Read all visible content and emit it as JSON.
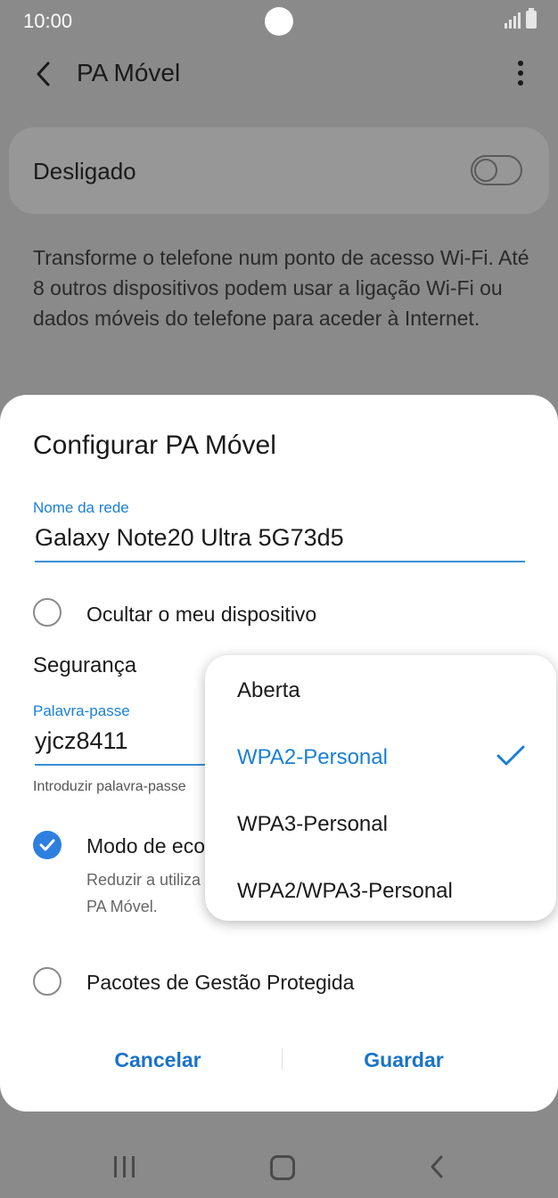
{
  "status_bar": {
    "time": "10:00"
  },
  "app_bar": {
    "title": "PA Móvel"
  },
  "toggle_card": {
    "label": "Desligado",
    "state": "off"
  },
  "description": "Transforme o telefone num ponto de acesso Wi-Fi. Até 8 outros dispositivos podem usar a ligação Wi-Fi ou dados móveis do telefone para aceder à Internet.",
  "dialog": {
    "title": "Configurar PA Móvel",
    "network_name": {
      "label": "Nome da rede",
      "value": "Galaxy Note20 Ultra 5G73d5"
    },
    "hide_device": {
      "label": "Ocultar o meu dispositivo",
      "checked": false
    },
    "security": {
      "label": "Segurança"
    },
    "password": {
      "label": "Palavra-passe",
      "value": "yjcz8411",
      "helper": "Introduzir palavra-passe"
    },
    "eco_mode": {
      "label": "Modo de eco",
      "sub_line1": "Reduzir a utiliza",
      "sub_line2": "PA Móvel.",
      "checked": true
    },
    "pmf": {
      "label": "Pacotes de Gestão Protegida",
      "checked": false
    },
    "buttons": {
      "cancel": "Cancelar",
      "save": "Guardar"
    }
  },
  "security_dropdown": {
    "options": [
      "Aberta",
      "WPA2-Personal",
      "WPA3-Personal",
      "WPA2/WPA3-Personal"
    ],
    "selected": "WPA2-Personal"
  },
  "colors": {
    "accent": "#1a7fd6",
    "button": "#1a73c8",
    "checked_radio": "#2d7fe0"
  },
  "icons": [
    "back-icon",
    "more-vert-icon",
    "check-icon",
    "nav-recent-icon",
    "nav-home-icon",
    "nav-back-icon"
  ]
}
